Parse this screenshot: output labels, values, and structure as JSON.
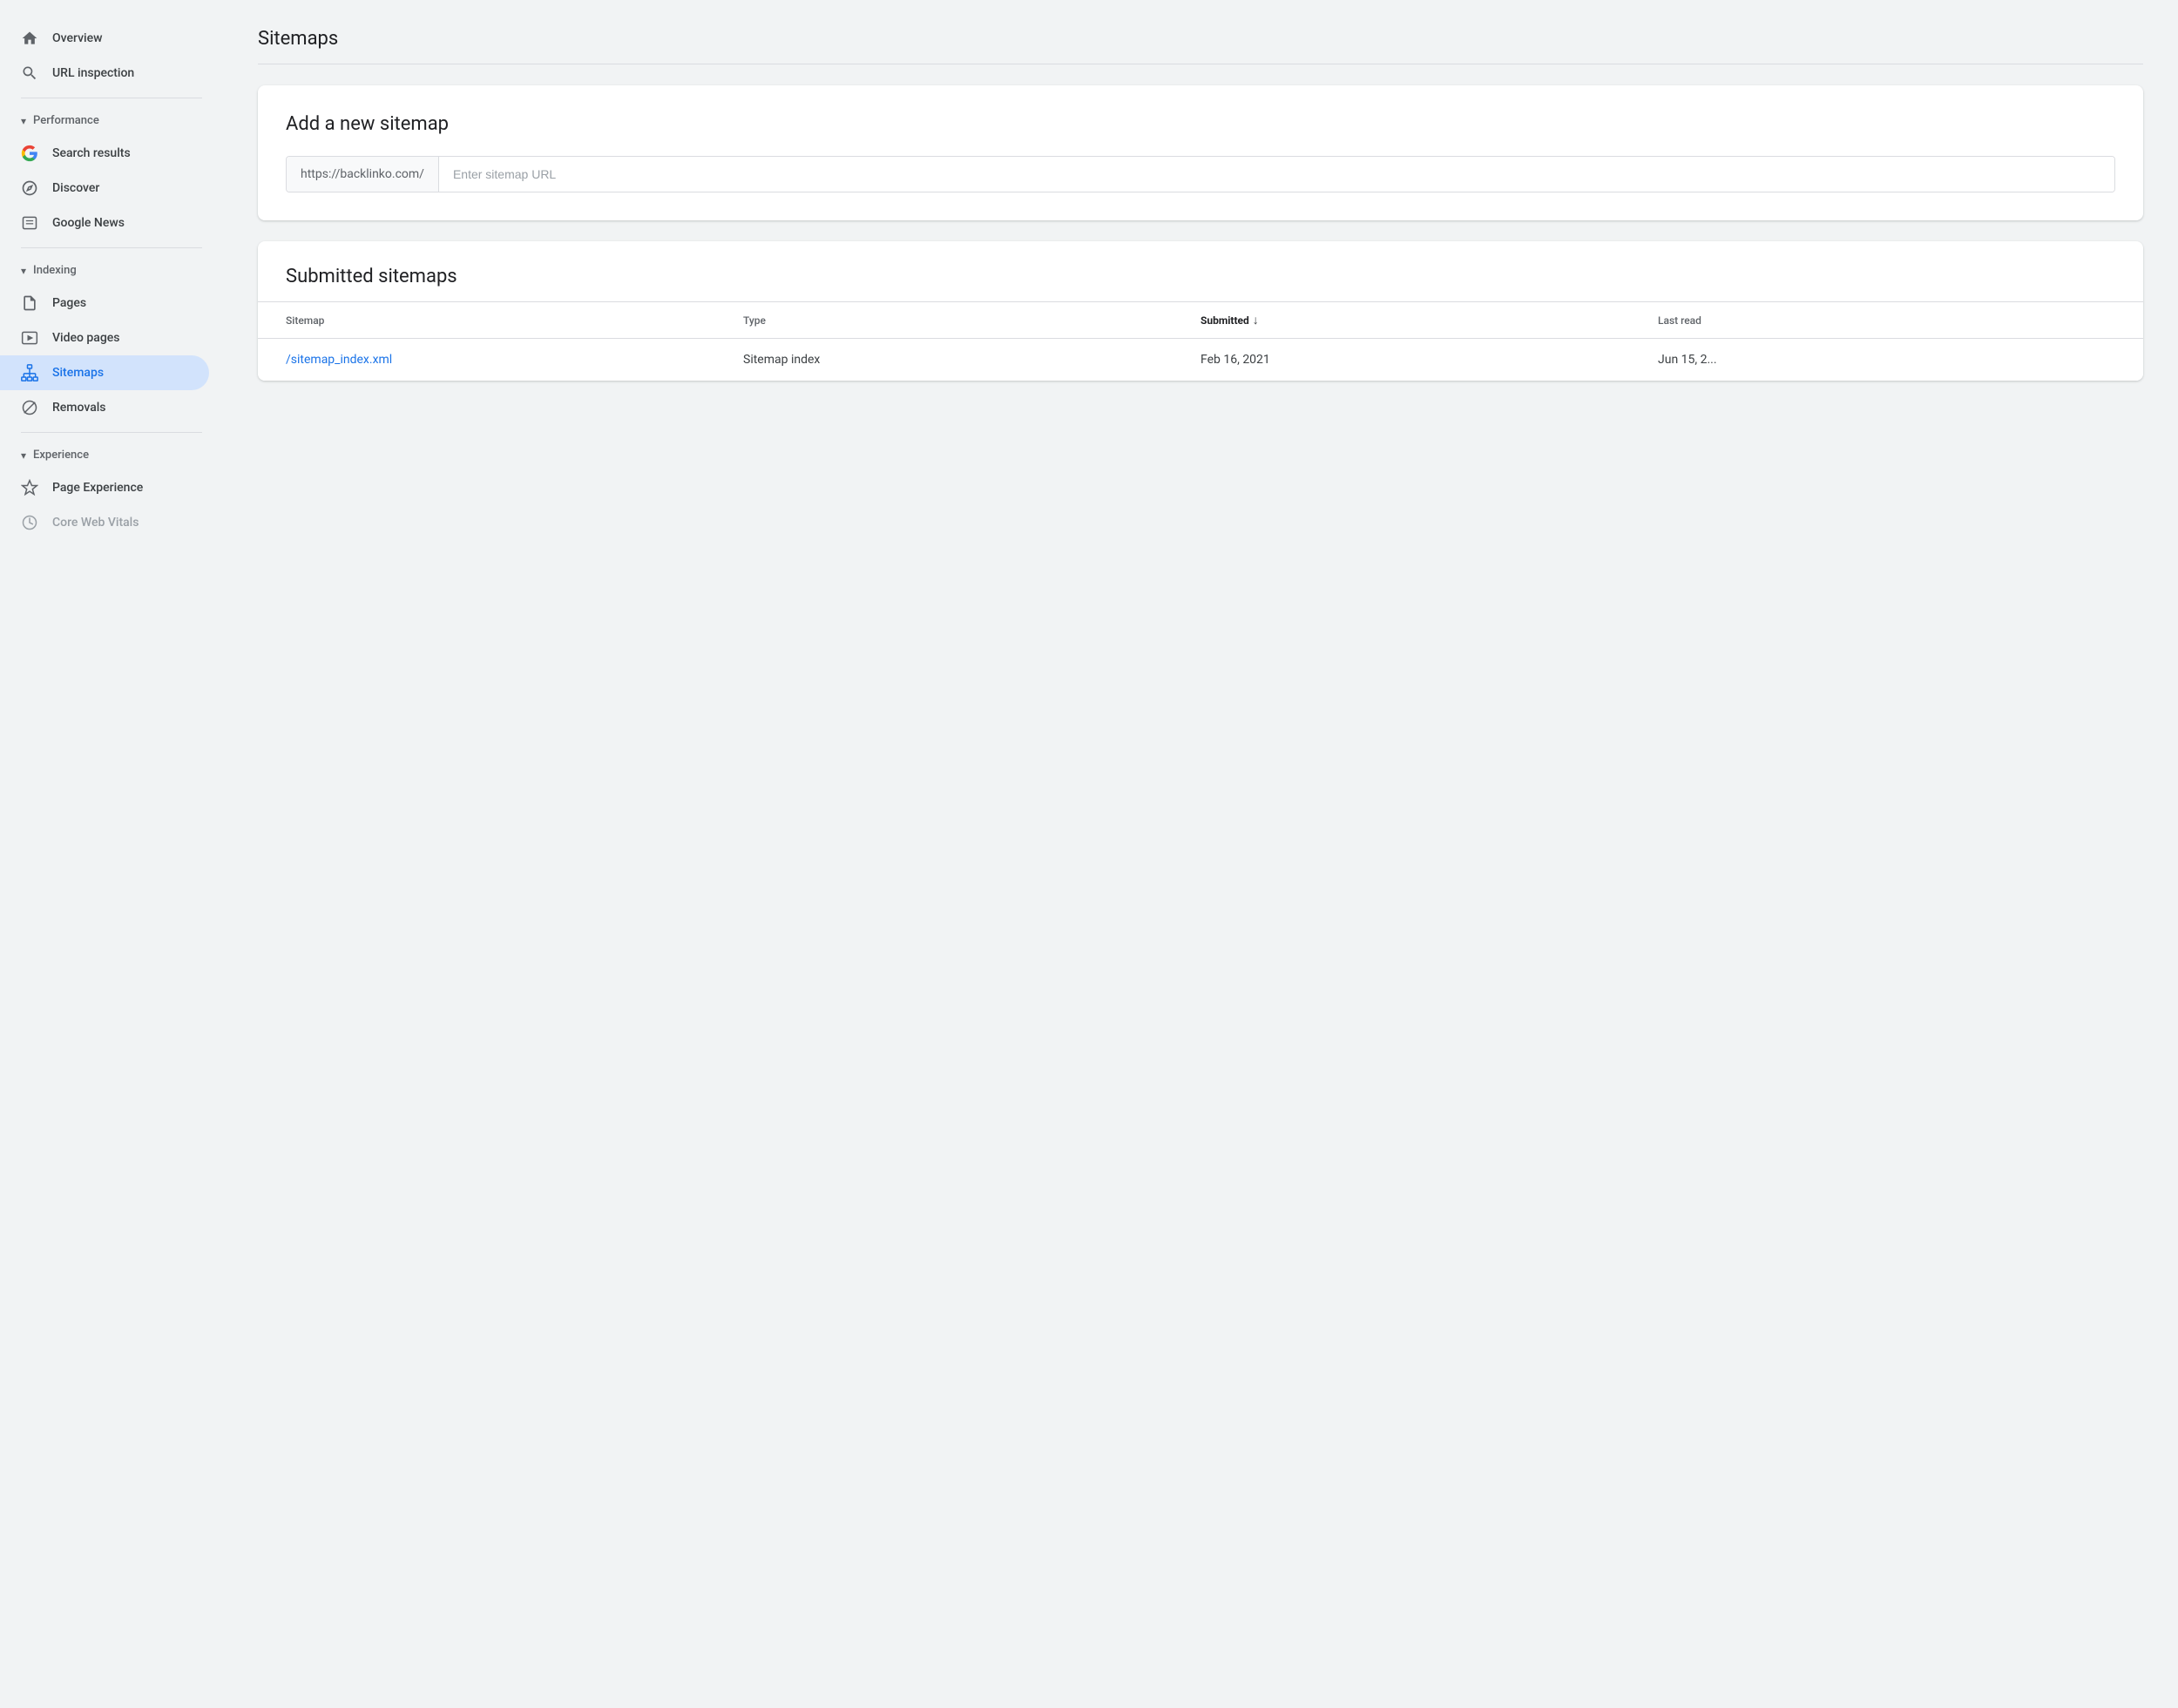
{
  "sidebar": {
    "overview_label": "Overview",
    "url_inspection_label": "URL inspection",
    "performance_label": "Performance",
    "search_results_label": "Search results",
    "discover_label": "Discover",
    "google_news_label": "Google News",
    "indexing_label": "Indexing",
    "pages_label": "Pages",
    "video_pages_label": "Video pages",
    "sitemaps_label": "Sitemaps",
    "removals_label": "Removals",
    "experience_label": "Experience",
    "page_experience_label": "Page Experience",
    "core_web_vitals_label": "Core Web Vitals"
  },
  "main": {
    "page_title": "Sitemaps",
    "add_sitemap_title": "Add a new sitemap",
    "base_url": "https://backlinko.com/",
    "sitemap_input_placeholder": "Enter sitemap URL",
    "submitted_sitemaps_title": "Submitted sitemaps",
    "table_headers": {
      "sitemap": "Sitemap",
      "type": "Type",
      "submitted": "Submitted",
      "last_read": "Last read"
    },
    "table_rows": [
      {
        "sitemap": "/sitemap_index.xml",
        "type": "Sitemap index",
        "submitted": "Feb 16, 2021",
        "last_read": "Jun 15, 2..."
      }
    ]
  }
}
